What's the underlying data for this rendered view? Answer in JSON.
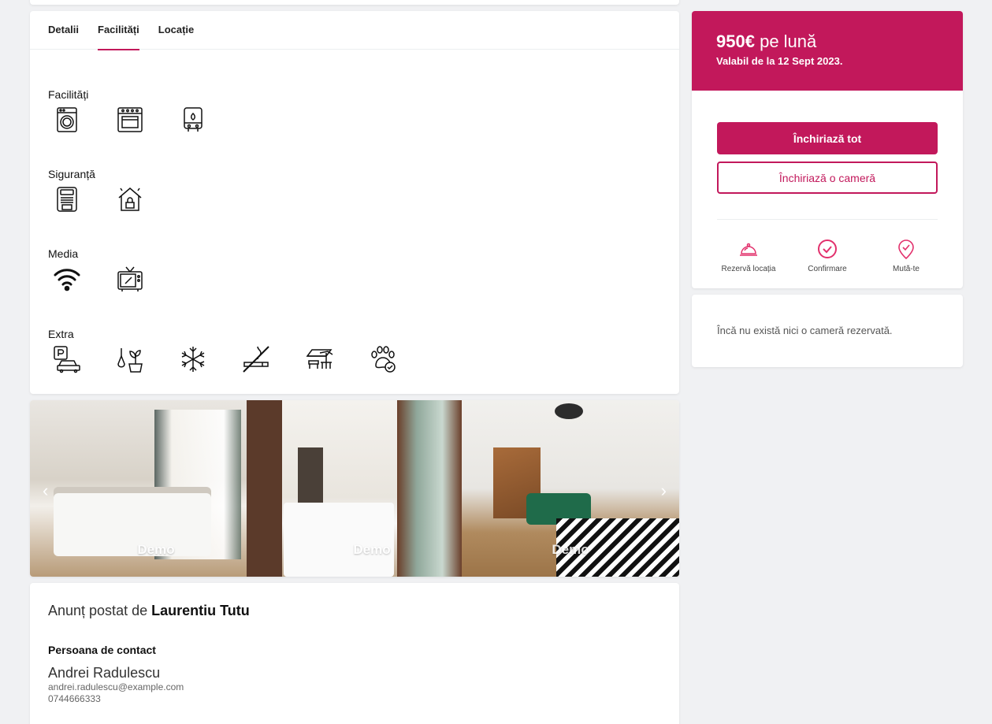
{
  "tabs": [
    "Detalii",
    "Facilități",
    "Locație"
  ],
  "sections": {
    "facilitati": "Facilități",
    "siguranta": "Siguranță",
    "media": "Media",
    "extra": "Extra"
  },
  "icons": {
    "facilitati": [
      "washing-machine-icon",
      "oven-icon",
      "boiler-icon"
    ],
    "siguranta": [
      "smoke-detector-icon",
      "house-alarm-icon"
    ],
    "media": [
      "wifi-icon",
      "tv-icon"
    ],
    "extra": [
      "parking-icon",
      "garden-icon",
      "air-conditioning-icon",
      "no-smoking-icon",
      "terrace-icon",
      "pets-allowed-icon"
    ]
  },
  "gallery": {
    "photos": [
      "Demo",
      "Demo",
      "Demo"
    ]
  },
  "poster": {
    "prefix": "Anunț postat de",
    "name": "Laurentiu Tutu",
    "contact_title": "Persoana de contact",
    "contact_name": "Andrei Radulescu",
    "email": "andrei.radulescu@example.com",
    "phone": "0744666333"
  },
  "price": {
    "amount": "950€",
    "period": "pe lună",
    "valid": "Valabil de la 12 Sept 2023."
  },
  "buttons": {
    "rent_all": "Închiriază tot",
    "rent_room": "Închiriază o cameră"
  },
  "steps": [
    "Rezervă locația",
    "Confirmare",
    "Mută-te"
  ],
  "rooms": {
    "empty": "Încă nu există nici o cameră rezervată."
  },
  "colors": {
    "accent": "#c2185b",
    "background": "#f0f1f3"
  }
}
